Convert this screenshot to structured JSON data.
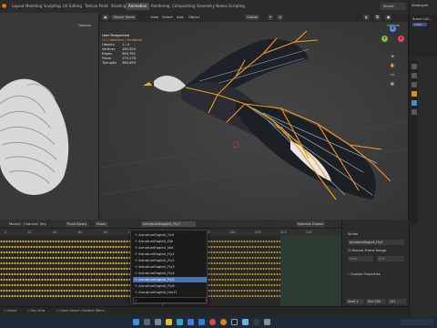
{
  "menu": {
    "tabs": [
      "Layout",
      "Modeling",
      "Sculpting",
      "UV Editing",
      "Texture Paint",
      "Shading",
      "Animation",
      "Rendering",
      "Compositing",
      "Geometry Nodes",
      "Scripting"
    ],
    "active_tab": "Animation",
    "scene_label": "Scene",
    "view_layer_label": "ViewLayer"
  },
  "left_view": {
    "options_label": "Options"
  },
  "viewport": {
    "mode": "Object Mode",
    "view": "View",
    "select": "Select",
    "add": "Add",
    "object": "Object",
    "orientation": "Global",
    "options_label": "Options",
    "perspective_title": "User Perspective",
    "collection_info": "(1) Collection | Armature",
    "stats": [
      {
        "label": "Objects",
        "value": "1 / 4"
      },
      {
        "label": "Vertices",
        "value": "180,520"
      },
      {
        "label": "Edges",
        "value": "360,782"
      },
      {
        "label": "Faces",
        "value": "179,178"
      },
      {
        "label": "Triangles",
        "value": "360,093"
      }
    ],
    "gizmo": {
      "x": "X",
      "y": "Y",
      "z": "Z"
    }
  },
  "outliner": {
    "items": [
      "Scene Coll...",
      "Colle..."
    ]
  },
  "dopesheet": {
    "menus": [
      "Marker",
      "Channel",
      "Key"
    ],
    "push_down": "Push Down",
    "stash": "Stash",
    "action_name": "ArmatureEagleA_Fly3",
    "nearest_frame": "Nearest Frame",
    "ticks": [
      "0",
      "20",
      "40",
      "60",
      "80",
      "100",
      "120",
      "140",
      "160",
      "180",
      "200",
      "220",
      "240"
    ],
    "current_frame_label": "121"
  },
  "action_dropdown": {
    "items": [
      "ArmatureEagleA_Cell",
      "ArmatureEagleA_Die",
      "ArmatureEagleA_Idle",
      "ArmatureEagleA_Fly1",
      "ArmatureEagleA_Fly2",
      "ArmatureEagleA_Fly3",
      "ArmatureEagleA_Fly4",
      "ArmatureEagleA_Fly5",
      "ArmatureEagleA_Fly6",
      "ArmatureEagleA_Hurt1"
    ],
    "selected_index": 7,
    "search_placeholder": ""
  },
  "action_panel": {
    "title": "Action",
    "action_value": "ArmatureEagleA_Fly3",
    "manual_frame_range": "Manual Frame Range",
    "start_label": "Start",
    "end_label": "End",
    "custom_properties": "Custom Properties"
  },
  "playback": {
    "start_label": "Start",
    "start_value": "1",
    "end_label": "End",
    "end_value": "250",
    "current": "121"
  },
  "status": {
    "left": "Select",
    "middle": "Pan View",
    "right": "Close Search Context Menu"
  },
  "taskbar": {
    "icons": [
      "windows-icon",
      "search-icon",
      "task-view-icon",
      "file-explorer-icon",
      "edge-icon",
      "store-icon",
      "mail-icon",
      "chrome-icon",
      "blender-icon",
      "steam-icon",
      "photos-icon",
      "terminal-icon",
      "settings-icon"
    ]
  },
  "colors": {
    "accent": "#4772b3",
    "bone": "#f29b1d",
    "keyframe": "#e2b535",
    "timeline_green": "#2f4a39",
    "playhead": "#4b7bd6"
  }
}
